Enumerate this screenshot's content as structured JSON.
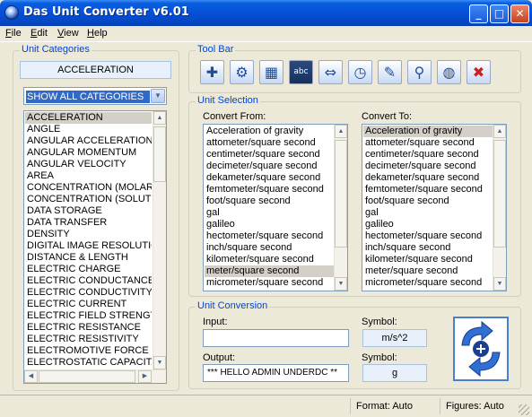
{
  "window": {
    "title": "Das Unit Converter v6.01",
    "icon": "app-globe-icon"
  },
  "menu": [
    {
      "key": "F",
      "rest": "ile"
    },
    {
      "key": "E",
      "rest": "dit"
    },
    {
      "key": "V",
      "rest": "iew"
    },
    {
      "key": "H",
      "rest": "elp"
    }
  ],
  "categories_panel": {
    "title": "Unit Categories",
    "current_category": "ACCELERATION",
    "filter_value": "SHOW ALL CATEGORIES",
    "items": [
      "ACCELERATION",
      "ANGLE",
      "ANGULAR ACCELERATION",
      "ANGULAR MOMENTUM",
      "ANGULAR VELOCITY",
      "AREA",
      "CONCENTRATION (MOLAR)",
      "CONCENTRATION (SOLUTIO",
      "DATA STORAGE",
      "DATA TRANSFER",
      "DENSITY",
      "DIGITAL IMAGE RESOLUTION",
      "DISTANCE & LENGTH",
      "ELECTRIC CHARGE",
      "ELECTRIC CONDUCTANCE",
      "ELECTRIC CONDUCTIVITY",
      "ELECTRIC CURRENT",
      "ELECTRIC FIELD STRENGTH",
      "ELECTRIC RESISTANCE",
      "ELECTRIC RESISTIVITY",
      "ELECTROMOTIVE FORCE",
      "ELECTROSTATIC CAPACITAN"
    ],
    "selected_index": 0
  },
  "toolbar": {
    "title": "Tool Bar",
    "tools": [
      {
        "name": "add-unit-icon",
        "glyph": "✚"
      },
      {
        "name": "settings-gear-icon",
        "glyph": "⚙"
      },
      {
        "name": "calculator-icon",
        "glyph": "▦"
      },
      {
        "name": "abc-board-icon",
        "glyph": "abc"
      },
      {
        "name": "double-arrow-icon",
        "glyph": "⇔"
      },
      {
        "name": "clock-icon",
        "glyph": "◷"
      },
      {
        "name": "edit-notepad-icon",
        "glyph": "✎"
      },
      {
        "name": "magnifier-icon",
        "glyph": "⚲"
      },
      {
        "name": "globe-icon",
        "glyph": "◍"
      },
      {
        "name": "exit-icon",
        "glyph": "✖"
      }
    ]
  },
  "unit_selection": {
    "title": "Unit Selection",
    "from_label": "Convert From:",
    "to_label": "Convert To:",
    "units": [
      "Acceleration of gravity",
      "attometer/square second",
      "centimeter/square second",
      "decimeter/square second",
      "dekameter/square second",
      "femtometer/square second",
      "foot/square second",
      "gal",
      "galileo",
      "hectometer/square second",
      "inch/square second",
      "kilometer/square second",
      "meter/square second",
      "micrometer/square second"
    ],
    "from_selected_index": 12,
    "to_selected_index": 0
  },
  "conversion": {
    "title": "Unit Conversion",
    "input_label": "Input:",
    "input_value": "",
    "output_label": "Output:",
    "output_value": "*** HELLO ADMIN UNDERDC **",
    "symbol_label_1": "Symbol:",
    "symbol_from": "m/s^2",
    "symbol_label_2": "Symbol:",
    "symbol_to": "g"
  },
  "status": {
    "format": "Format: Auto",
    "figures": "Figures: Auto"
  },
  "colors": {
    "title_blue": "#0550d6",
    "group_title": "#0046d5",
    "selection": "#316ac5"
  }
}
